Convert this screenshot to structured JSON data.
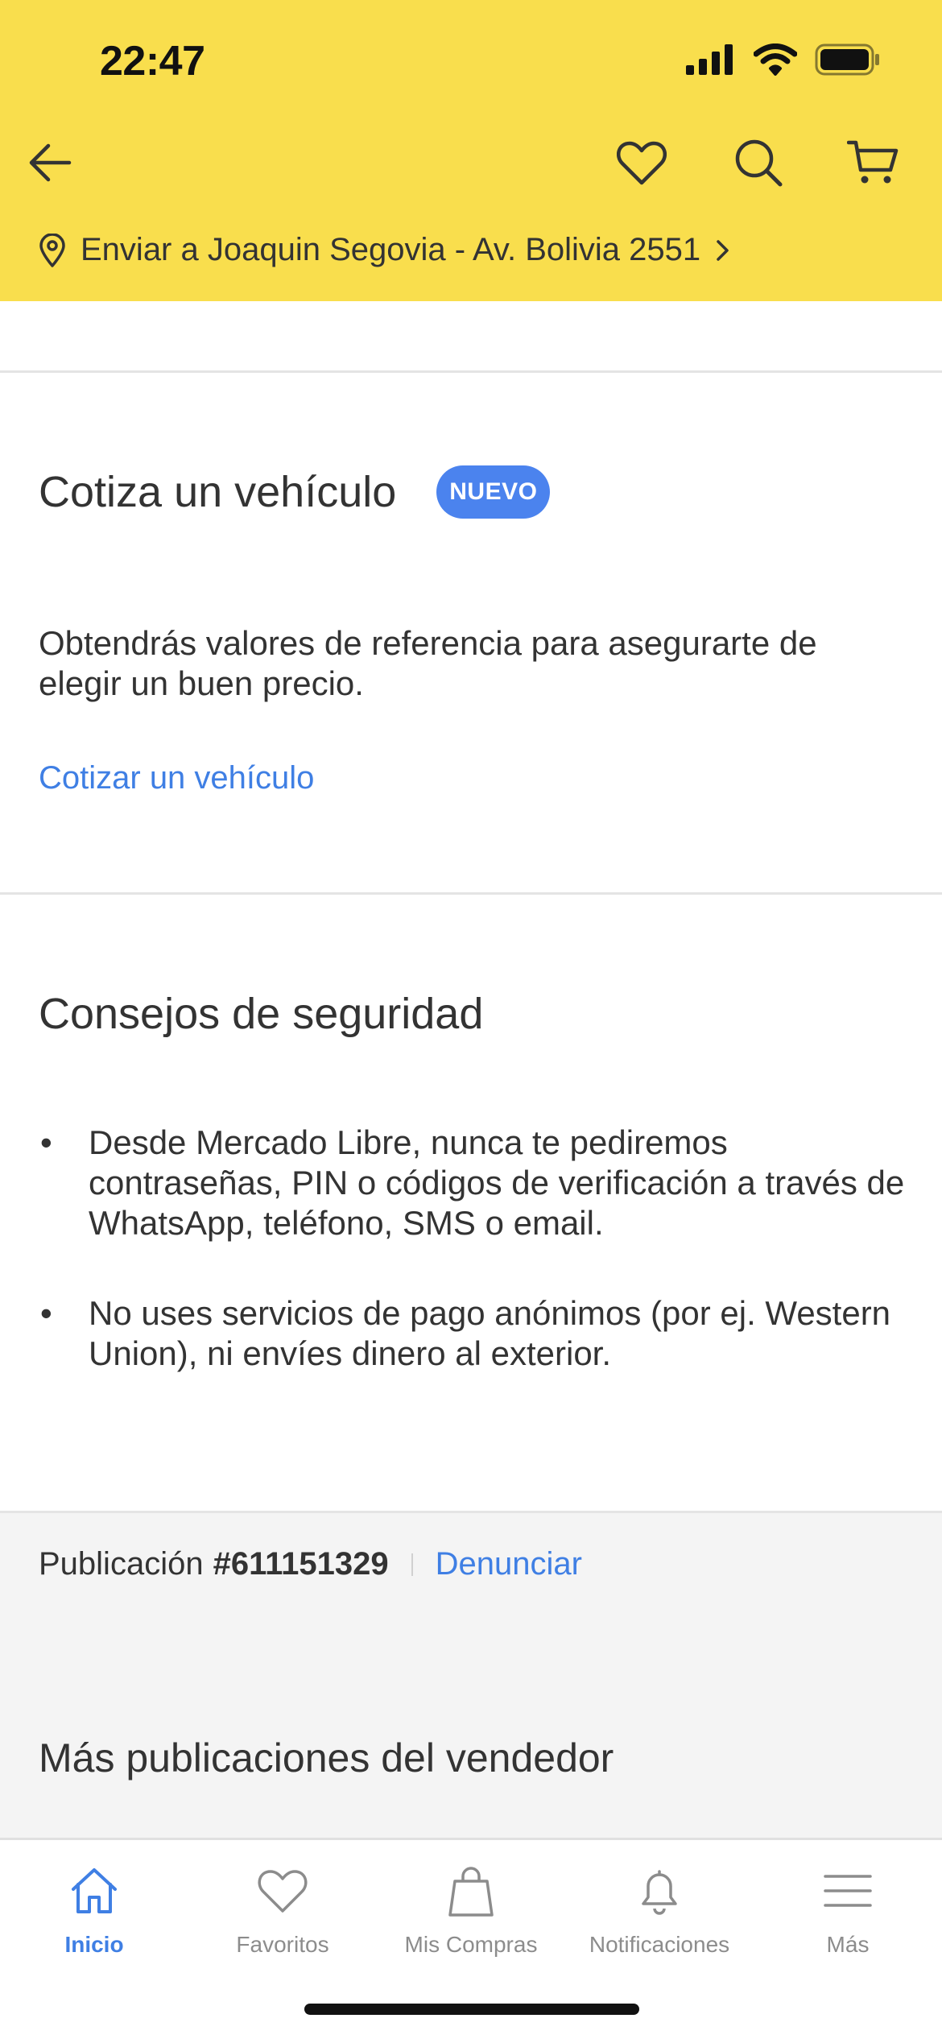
{
  "status_bar": {
    "time": "22:47"
  },
  "header": {
    "address": "Enviar a Joaquin Segovia - Av. Bolivia 2551"
  },
  "cotiza": {
    "title": "Cotiza un vehículo",
    "badge": "NUEVO",
    "description": "Obtendrás valores de referencia para asegurarte de elegir un buen precio.",
    "link": "Cotizar un vehículo"
  },
  "consejos": {
    "title": "Consejos de seguridad",
    "tips": [
      "Desde Mercado Libre, nunca te pediremos contraseñas, PIN o códigos de verificación a través de WhatsApp, teléfono, SMS o email.",
      "No uses servicios de pago anónimos (por ej. Western Union), ni envíes dinero al exterior."
    ]
  },
  "publication": {
    "label": "Publicación",
    "id": "#611151329",
    "report": "Denunciar"
  },
  "more_from_seller": "Más publicaciones del vendedor",
  "tabbar": {
    "items": [
      {
        "label": "Inicio",
        "icon": "home-icon",
        "active": true
      },
      {
        "label": "Favoritos",
        "icon": "heart-icon",
        "active": false
      },
      {
        "label": "Mis Compras",
        "icon": "shopping-bag-icon",
        "active": false
      },
      {
        "label": "Notificaciones",
        "icon": "bell-icon",
        "active": false
      },
      {
        "label": "Más",
        "icon": "menu-icon",
        "active": false
      }
    ]
  },
  "colors": {
    "header_bg": "#f9de4d",
    "accent_blue": "#3f7fe4",
    "badge_blue": "#4b83ee",
    "grey_bg": "#f4f4f4"
  }
}
